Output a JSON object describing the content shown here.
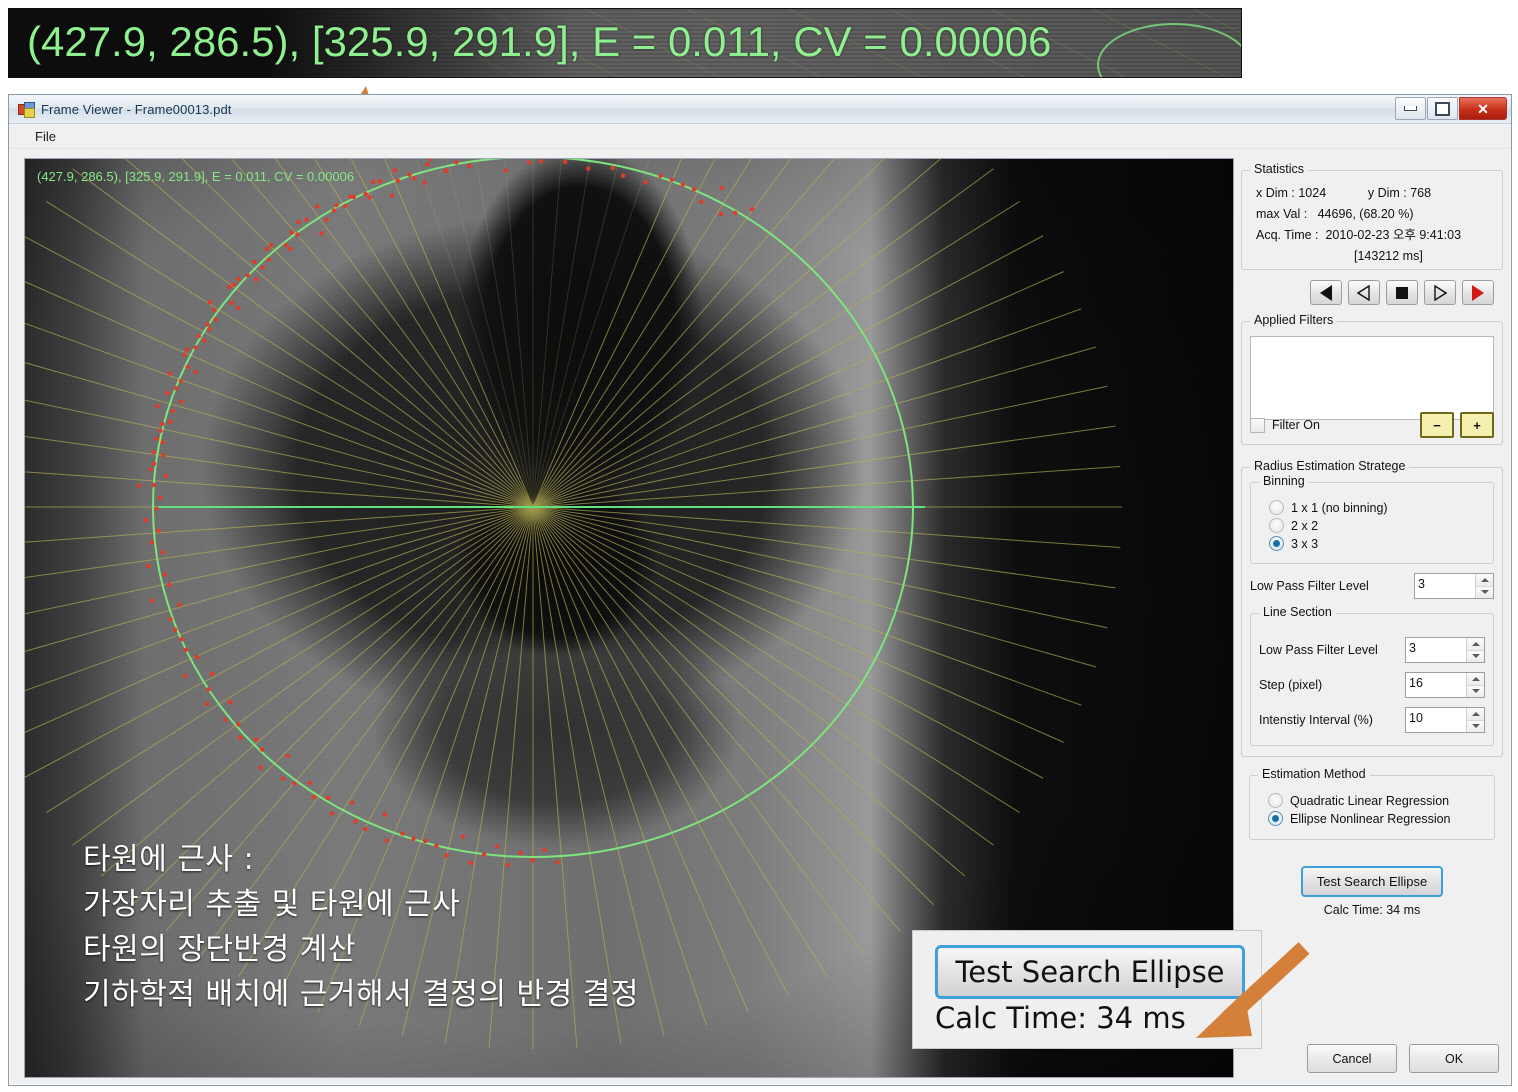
{
  "callout_top": {
    "name": "magnified-overlay-text",
    "text": "(427.9, 286.5), [325.9, 291.9], E = 0.011, CV = 0.00006"
  },
  "window": {
    "title": "Frame Viewer - Frame00013.pdt",
    "icon": "app-icon",
    "controls": {
      "minimize": "–",
      "maximize": "❐",
      "close": "✕"
    }
  },
  "menu": {
    "items": [
      "File"
    ]
  },
  "viewer": {
    "overlay_text": "(427.9, 286.5), [325.9, 291.9], E = 0.011, CV = 0.00006",
    "annotation": "타원에 근사 :\n가장자리 추출 및 타원에 근사\n타원의  장단반경  계산\n기하학적 배치에 근거해서 결정의 반경 결정",
    "colors": {
      "ellipse": "#7ee47e",
      "rays": "#b5ad55",
      "edge_points": "#e03c2a",
      "center_line": "#64e07f",
      "overlay_text": "#86e886"
    }
  },
  "statistics": {
    "legend": "Statistics",
    "line1": "x Dim : 1024            y Dim : 768",
    "line2": "max Val :   44696, (68.20 %)",
    "line3": "Acq. Time :  2010-02-23 오후 9:41:03",
    "line4": "[143212 ms]",
    "x_dim": "1024",
    "y_dim": "768",
    "max_val": "44696",
    "max_val_pct": "68.20 %",
    "acq_time": "2010-02-23 오후 9:41:03",
    "acq_ms": "143212 ms"
  },
  "nav_buttons": [
    {
      "name": "first-frame-button",
      "icon": "triangle-left-filled"
    },
    {
      "name": "prev-frame-button",
      "icon": "triangle-left-outline"
    },
    {
      "name": "stop-button",
      "icon": "square-filled"
    },
    {
      "name": "next-frame-button",
      "icon": "triangle-right-outline"
    },
    {
      "name": "play-button",
      "icon": "triangle-right-filled-red"
    }
  ],
  "filters": {
    "legend": "Applied Filters",
    "list_items": [],
    "filter_on_label": "Filter On",
    "filter_on_checked": false,
    "minus_label": "−",
    "plus_label": "+",
    "button_color": "#f5efb0"
  },
  "radius": {
    "legend": "Radius Estimation Stratege",
    "binning": {
      "legend": "Binning",
      "options": [
        {
          "label": "1 x 1 (no binning)",
          "selected": false
        },
        {
          "label": "2 x 2",
          "selected": false
        },
        {
          "label": "3 x 3",
          "selected": true
        }
      ]
    },
    "low_pass_label": "Low Pass Filter Level",
    "low_pass_value": "3",
    "line_section": {
      "legend": "Line Section",
      "fields": [
        {
          "label": "Low Pass Filter Level",
          "value": "3"
        },
        {
          "label": "Step (pixel)",
          "value": "16"
        },
        {
          "label": "Intenstiy Interval (%)",
          "value": "10"
        }
      ]
    }
  },
  "estimation": {
    "legend": "Estimation Method",
    "options": [
      {
        "label": "Quadratic Linear Regression",
        "selected": false
      },
      {
        "label": "Ellipse Nonlinear Regression",
        "selected": true
      }
    ],
    "test_button": "Test Search Ellipse",
    "calc_time": "Calc Time: 34 ms"
  },
  "dialog": {
    "cancel": "Cancel",
    "ok": "OK"
  },
  "callout_bottom": {
    "button_label": "Test Search Ellipse",
    "calc_time": "Calc Time: 34 ms"
  },
  "arrows": {
    "color": "#d4803a"
  }
}
